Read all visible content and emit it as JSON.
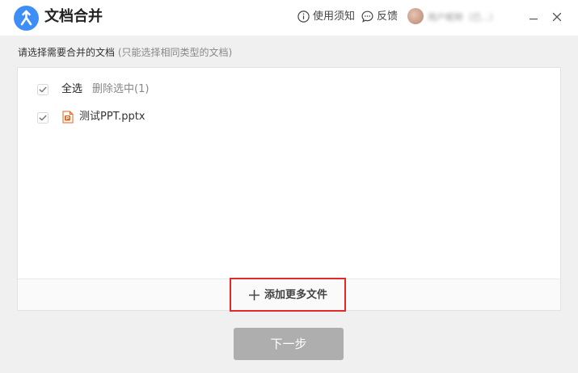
{
  "app": {
    "title": "文档合并",
    "logo_icon": "merge-icon",
    "accent_color": "#3e8ef7"
  },
  "header": {
    "help": {
      "icon": "info-icon",
      "label": "使用须知"
    },
    "feedback": {
      "icon": "chat-bubble-icon",
      "label": "反馈"
    },
    "user": {
      "avatar_icon": "avatar",
      "name": "用户昵称（已...）"
    },
    "controls": [
      "minimize-icon",
      "close-icon"
    ]
  },
  "instruction": {
    "text": "请选择需要合并的文档",
    "note": "(只能选择相同类型的文档)"
  },
  "file_list": {
    "select_all": {
      "label": "全选",
      "checked": true
    },
    "delete_selected": "删除选中(1)",
    "files": [
      {
        "name": "测试PPT.pptx",
        "type_icon": "pptx-file-icon",
        "checked": true
      }
    ]
  },
  "actions": {
    "add_files_label": "添加更多文件",
    "add_files_highlight_color": "#e02b2b",
    "next_label": "下一步",
    "next_disabled_color": "#aeaeae"
  }
}
